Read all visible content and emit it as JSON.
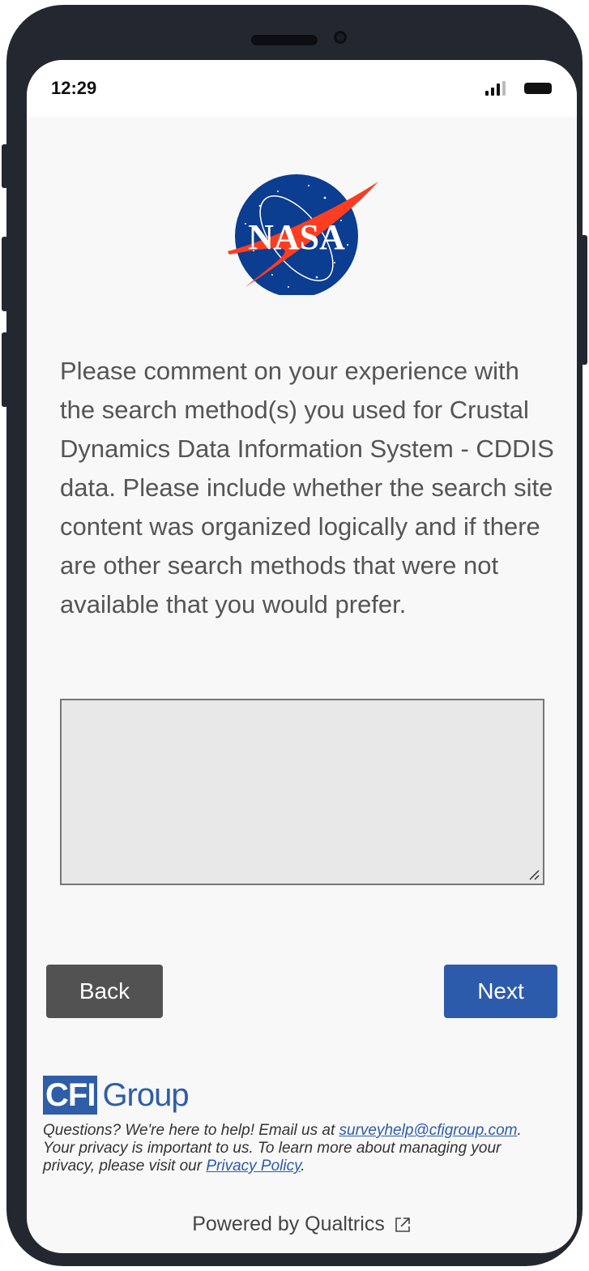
{
  "status_bar": {
    "time": "12:29"
  },
  "brand": {
    "logo_text": "NASA"
  },
  "question": {
    "text": "Please comment on your experience with the search method(s) you used for Crustal Dynamics Data Information System - CDDIS data. Please include whether the search site content was organized logically and if there are other search methods that were not available that you would prefer."
  },
  "answer": {
    "value": "",
    "placeholder": ""
  },
  "nav": {
    "back_label": "Back",
    "next_label": "Next"
  },
  "footer": {
    "cfi_box": "CFI",
    "cfi_word": "Group",
    "help_prefix": "Questions? We're here to help! Email us at ",
    "help_email": "surveyhelp@cfigroup.com",
    "help_suffix": ".",
    "privacy_prefix": "Your privacy is important to us. To learn more about managing your privacy, please visit our ",
    "privacy_link": "Privacy Policy",
    "privacy_suffix": ".",
    "powered_by": "Powered by Qualtrics"
  },
  "colors": {
    "next_button": "#2d5bab",
    "back_button": "#525252",
    "nasa_blue": "#0b3d91",
    "nasa_red": "#fc3d21",
    "cfi_blue": "#2f5da8"
  },
  "icons": [
    "signal-icon",
    "battery-icon",
    "resize-grip-icon",
    "external-link-icon"
  ]
}
